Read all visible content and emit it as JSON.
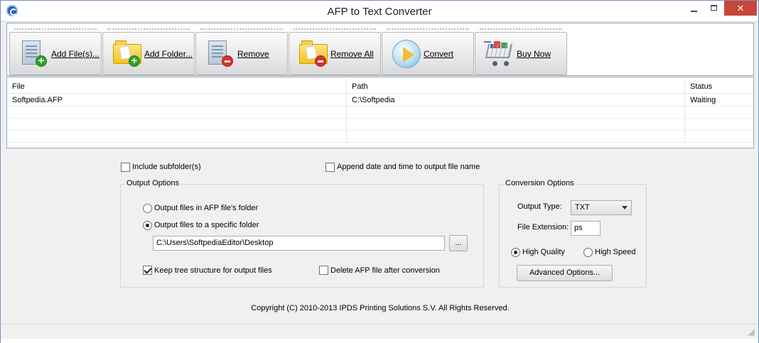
{
  "window": {
    "title": "AFP to Text Converter",
    "minimize": "minimize",
    "maximize": "maximize",
    "close": "close"
  },
  "toolbar": {
    "buttons": [
      {
        "label": "Add File(s)...",
        "icon": "add-file-icon"
      },
      {
        "label": "Add Folder...",
        "icon": "add-folder-icon"
      },
      {
        "label": "Remove",
        "icon": "remove-file-icon"
      },
      {
        "label": "Remove All",
        "icon": "remove-all-folder-icon"
      },
      {
        "label": "Convert",
        "icon": "play-icon"
      },
      {
        "label": "Buy Now",
        "icon": "shopping-cart-icon"
      }
    ]
  },
  "file_list": {
    "columns": [
      "File",
      "Path",
      "Status"
    ],
    "rows": [
      [
        "Softpedia.AFP",
        "C:\\Softpedia",
        "Waiting"
      ]
    ]
  },
  "options": {
    "include_subfolders": {
      "label": "Include subfolder(s)",
      "checked": false
    },
    "append_datetime": {
      "label": "Append date and time to output file name",
      "checked": false
    }
  },
  "output_options": {
    "title": "Output Options",
    "radio_same_folder": {
      "label": "Output files in AFP file's folder",
      "selected": false
    },
    "radio_specific_folder": {
      "label": "Output files to a specific folder",
      "selected": true
    },
    "folder_path": "C:\\Users\\SoftpediaEditor\\Desktop",
    "browse_label": "...",
    "keep_tree": {
      "label": "Keep tree structure for output files",
      "checked": true
    },
    "delete_afp": {
      "label": "Delete AFP file after conversion",
      "checked": false
    }
  },
  "conversion_options": {
    "title": "Conversion Options",
    "output_type_label": "Output Type:",
    "output_type_value": "TXT",
    "file_extension_label": "File Extension:",
    "file_extension_value": "ps",
    "high_quality": {
      "label": "High Quality",
      "selected": true
    },
    "high_speed": {
      "label": "High Speed",
      "selected": false
    },
    "advanced_label": "Advanced Options..."
  },
  "footer": {
    "copyright": "Copyright (C) 2010-2013 IPDS Printing Solutions S.V.  All Rights Reserved."
  },
  "colors": {
    "accent": "#6f93c2",
    "close_button": "#c7463b",
    "window_bg": "#f0f0f0"
  }
}
